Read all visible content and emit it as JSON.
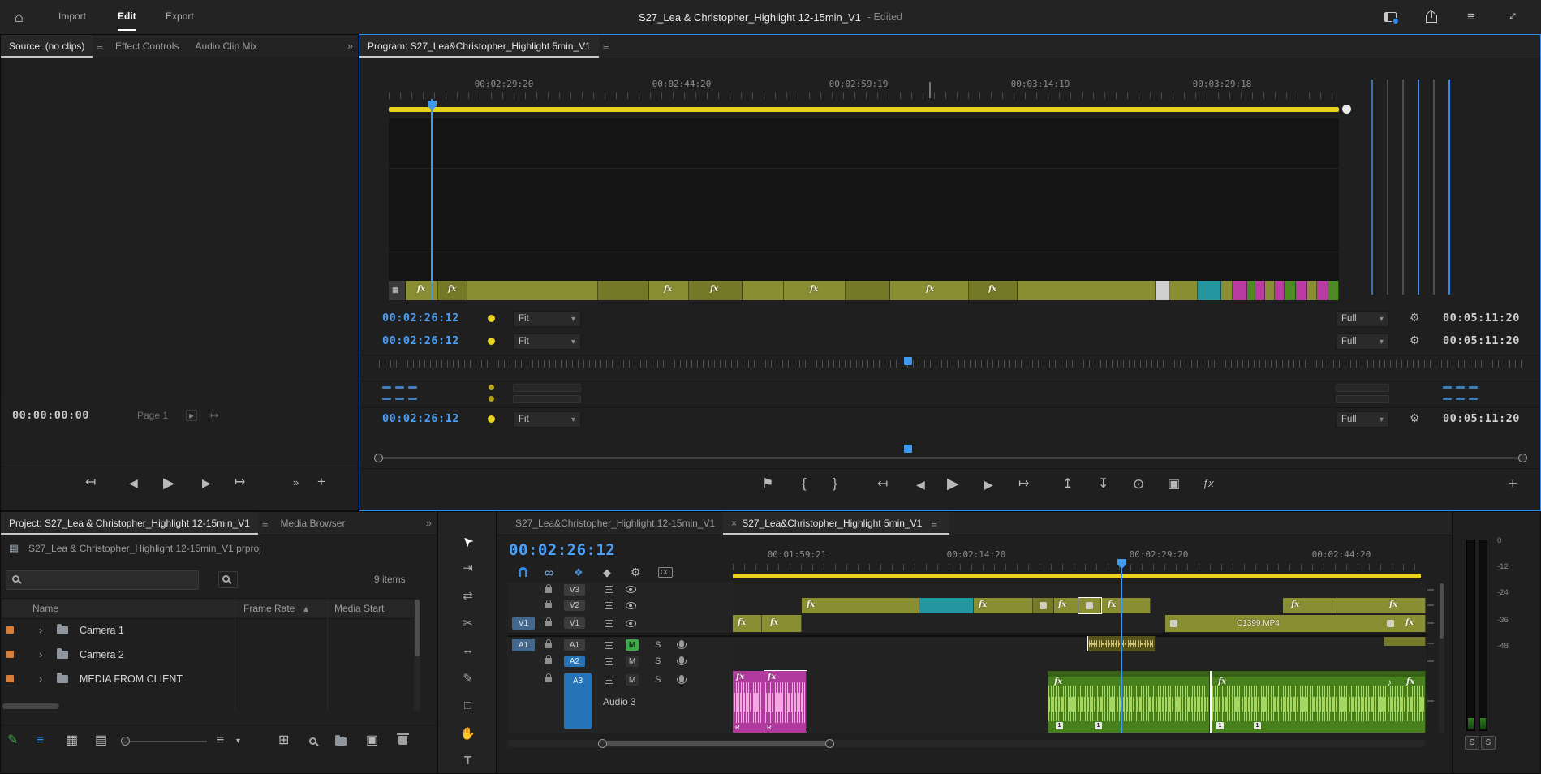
{
  "colors": {
    "accent_blue": "#2d8ceb",
    "timecode_blue": "#4ba0f8",
    "work_area_yellow": "#e8d21c",
    "clip_olive": "#8a8e33",
    "clip_teal": "#2396a0",
    "clip_magenta": "#b93ba1",
    "clip_green": "#4c8a22",
    "mute_green": "#3ea84a",
    "bin_label_orange": "#d97e36"
  },
  "labels": {
    "fx": "fx",
    "clip_name": "C1399.MP4",
    "channel_r": "R",
    "marker_one": "1"
  },
  "icons": {
    "home": "⌂",
    "menu": "≡",
    "fullscreen": "↕",
    "overflow": "»",
    "plus": "+",
    "close": "×",
    "caret_down": "▾",
    "sort_up": "▴",
    "chevron_right": "›",
    "play": "▶",
    "step_back": "◀",
    "step_forward": "▶",
    "go_to_in": "↤",
    "go_to_out": "↦",
    "mark_in": "{",
    "mark_out": "}",
    "add_marker": "⚑",
    "lift": "↥",
    "extract": "↧",
    "export_frame": "⊙",
    "comparison": "▣",
    "fx_mute": "ƒx",
    "page_next": "▸",
    "go_to_end": "↦",
    "nest": "❖",
    "linked_selection": "∞",
    "wrench": "⚙",
    "captions": "CC",
    "marker_diamond": "◆",
    "music_note": "♪",
    "grid_view": "▦",
    "freeform_view": "▤",
    "list_view": "≡",
    "automate": "⊞",
    "new_item": "▣",
    "sort": "≡",
    "film": "▦",
    "tool_selection": "➤",
    "tool_track_select": "⇥",
    "tool_ripple": "⇄",
    "tool_razor": "✂",
    "tool_slip": "↔",
    "tool_pen": "✎",
    "tool_rect": "□",
    "tool_hand": "✋",
    "tool_type": "T",
    "writable_pen": "✎"
  },
  "topbar": {
    "tabs": [
      {
        "label": "Import"
      },
      {
        "label": "Edit"
      },
      {
        "label": "Export"
      }
    ],
    "title": "S27_Lea & Christopher_Highlight 12-15min_V1",
    "edited_status": "- Edited"
  },
  "source_panel": {
    "tabs": [
      "Source: (no clips)",
      "Effect Controls",
      "Audio Clip Mix"
    ],
    "timecode": "00:00:00:00",
    "page_label": "Page 1"
  },
  "program_panel": {
    "title": "Program: S27_Lea&Christopher_Highlight 5min_V1",
    "ruler_labels": [
      "00:02:29:20",
      "00:02:44:20",
      "00:02:59:19",
      "00:03:14:19",
      "00:03:29:18"
    ],
    "control_rows": [
      {
        "timecode": "00:02:26:12",
        "zoom": "Fit",
        "playback_resolution": "Full",
        "duration": "00:05:11:20"
      },
      {
        "timecode": "00:02:26:12",
        "zoom": "Fit",
        "playback_resolution": "Full",
        "duration": "00:05:11:20"
      },
      {
        "timecode": "00:02:26:12",
        "zoom": "Fit",
        "playback_resolution": "Full",
        "duration": "00:05:11:20"
      }
    ]
  },
  "project_panel": {
    "tabs": [
      "Project: S27_Lea & Christopher_Highlight 12-15min_V1",
      "Media Browser"
    ],
    "project_file": "S27_Lea & Christopher_Highlight 12-15min_V1.prproj",
    "item_count": "9 items",
    "columns": {
      "name": "Name",
      "frame_rate": "Frame Rate",
      "media_start": "Media Start"
    },
    "rows": [
      {
        "name": "Camera 1"
      },
      {
        "name": "Camera 2"
      },
      {
        "name": "MEDIA FROM CLIENT"
      }
    ]
  },
  "timeline_panel": {
    "tabs": [
      "S27_Lea&Christopher_Highlight 12-15min_V1",
      "S27_Lea&Christopher_Highlight 5min_V1"
    ],
    "timecode": "00:02:26:12",
    "ruler_labels": [
      "00:01:59:21",
      "00:02:14:20",
      "00:02:29:20",
      "00:02:44:20"
    ],
    "tracks": {
      "v3": "V3",
      "v2": "V2",
      "v1": "V1",
      "a1": "A1",
      "a2": "A2",
      "a3": "A3",
      "a3_name": "Audio 3",
      "mute": "M",
      "solo": "S"
    }
  },
  "audio_meters": {
    "scale": [
      "0",
      "-12",
      "-24",
      "-36",
      "-48"
    ],
    "solo": "S"
  }
}
